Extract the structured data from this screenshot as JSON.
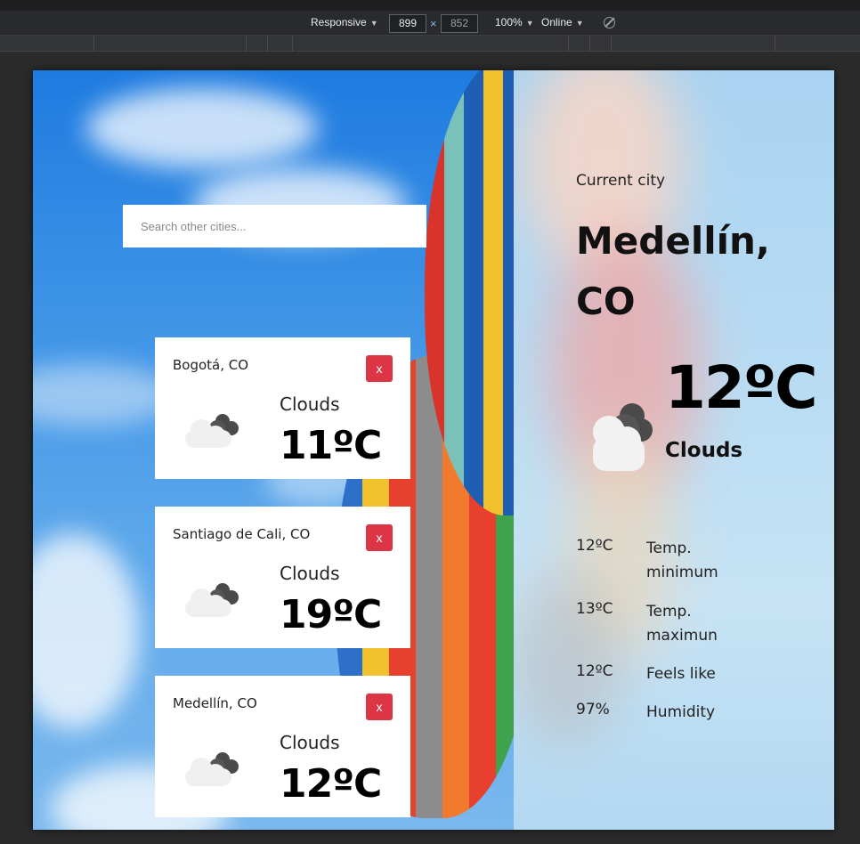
{
  "devtools": {
    "device": "Responsive",
    "width": "899",
    "height": "852",
    "times": "×",
    "zoom": "100%",
    "throttle": "Online",
    "caret": "▼"
  },
  "search": {
    "placeholder": "Search other cities..."
  },
  "cities": [
    {
      "name": "Bogotá, CO",
      "desc": "Clouds",
      "temp": "11ºC",
      "remove": "x"
    },
    {
      "name": "Santiago de Cali, CO",
      "desc": "Clouds",
      "temp": "19ºC",
      "remove": "x"
    },
    {
      "name": "Medellín, CO",
      "desc": "Clouds",
      "temp": "12ºC",
      "remove": "x"
    }
  ],
  "current": {
    "label": "Current city",
    "city": "Medellín, CO",
    "temp": "12ºC",
    "desc": "Clouds",
    "stats": [
      {
        "value": "12ºC",
        "label": "Temp. minimum"
      },
      {
        "value": "13ºC",
        "label": "Temp. maximun"
      },
      {
        "value": "12ºC",
        "label": "Feels like"
      },
      {
        "value": "97%",
        "label": "Humidity"
      }
    ]
  },
  "colors": {
    "remove_button": "#dc3545",
    "devtools_bg": "#292a2d"
  },
  "icons": {
    "weather": "cloud-icon",
    "rotate": "rotate-icon"
  }
}
